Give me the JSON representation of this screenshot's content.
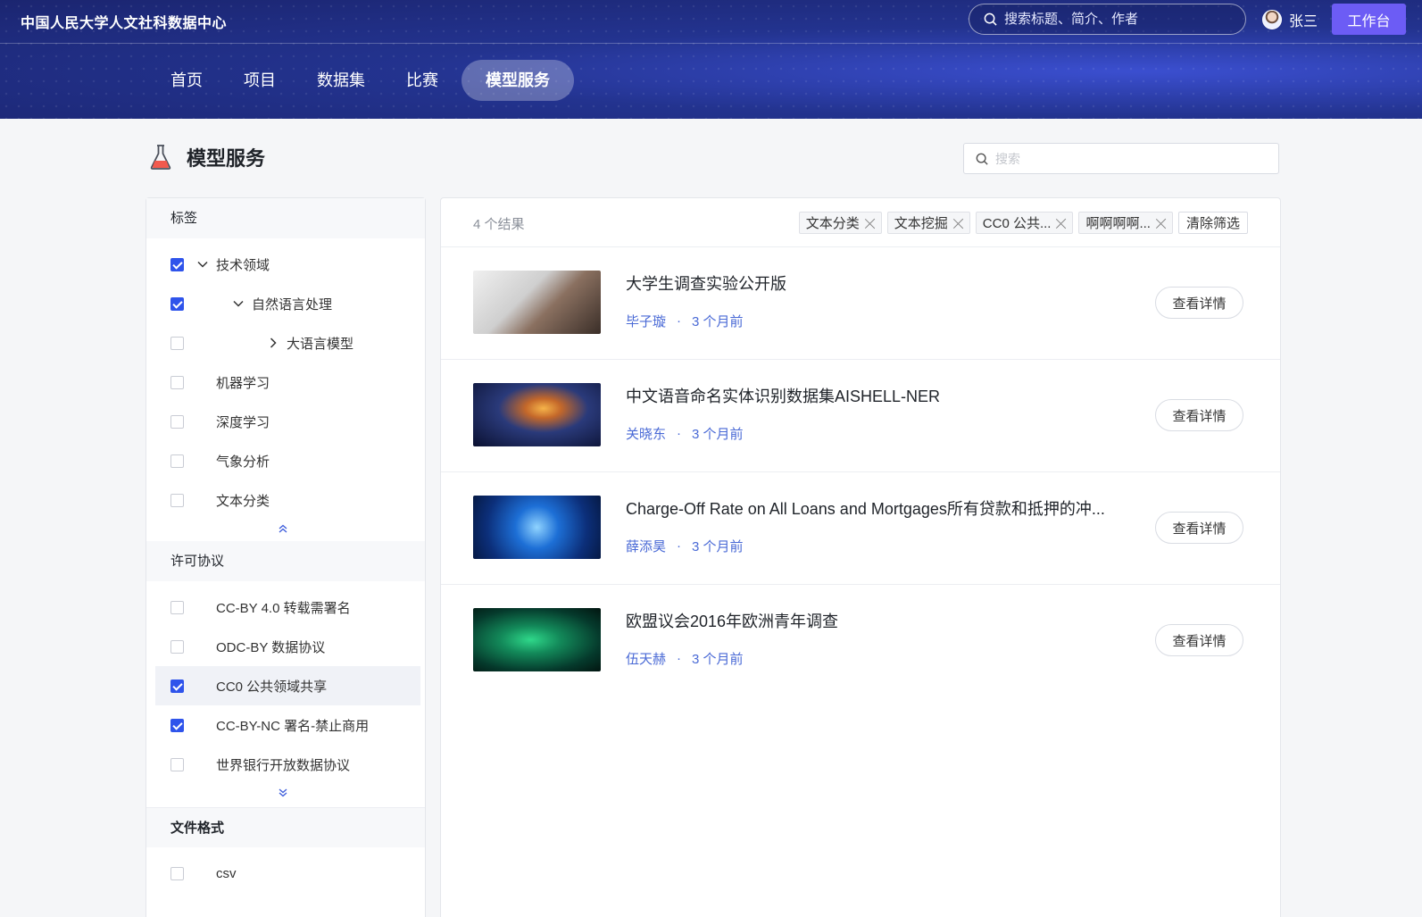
{
  "header": {
    "brand": "中国人民大学人文社科数据中心",
    "search_placeholder": "搜索标题、简介、作者",
    "user_name": "张三",
    "workbench_label": "工作台",
    "nav": [
      {
        "label": "首页",
        "active": false
      },
      {
        "label": "项目",
        "active": false
      },
      {
        "label": "数据集",
        "active": false
      },
      {
        "label": "比赛",
        "active": false
      },
      {
        "label": "模型服务",
        "active": true
      }
    ]
  },
  "page": {
    "title": "模型服务",
    "search_placeholder": "搜索"
  },
  "sidebar": {
    "tags_title": "标签",
    "tags": [
      {
        "label": "技术领域",
        "checked": true,
        "expand": "down",
        "level": 0
      },
      {
        "label": "自然语言处理",
        "checked": true,
        "expand": "down",
        "level": 1
      },
      {
        "label": "大语言模型",
        "checked": false,
        "expand": "right",
        "level": 2
      },
      {
        "label": "机器学习",
        "checked": false
      },
      {
        "label": "深度学习",
        "checked": false
      },
      {
        "label": "气象分析",
        "checked": false
      },
      {
        "label": "文本分类",
        "checked": false
      }
    ],
    "license_title": "许可协议",
    "licenses": [
      {
        "label": "CC-BY 4.0 转载需署名",
        "checked": false
      },
      {
        "label": "ODC-BY 数据协议",
        "checked": false
      },
      {
        "label": "CC0 公共领域共享",
        "checked": true,
        "highlight": true
      },
      {
        "label": "CC-BY-NC 署名-禁止商用",
        "checked": true
      },
      {
        "label": "世界银行开放数据协议",
        "checked": false
      }
    ],
    "format_title": "文件格式",
    "formats": [
      {
        "label": "csv",
        "checked": false
      }
    ]
  },
  "results": {
    "count_text": "4 个结果",
    "filters": [
      "文本分类",
      "文本挖掘",
      "CC0 公共...",
      "啊啊啊啊..."
    ],
    "clear_label": "清除筛选",
    "detail_label": "查看详情",
    "items": [
      {
        "title": "大学生调查实验公开版",
        "author": "毕子璇",
        "time": "3 个月前"
      },
      {
        "title": "中文语音命名实体识别数据集AISHELL-NER",
        "author": "关晓东",
        "time": "3 个月前"
      },
      {
        "title": "Charge-Off Rate on All Loans and Mortgages所有贷款和抵押的冲...",
        "author": "薛添昊",
        "time": "3 个月前"
      },
      {
        "title": "欧盟议会2016年欧洲青年调查",
        "author": "伍天赫",
        "time": "3 个月前"
      }
    ]
  }
}
